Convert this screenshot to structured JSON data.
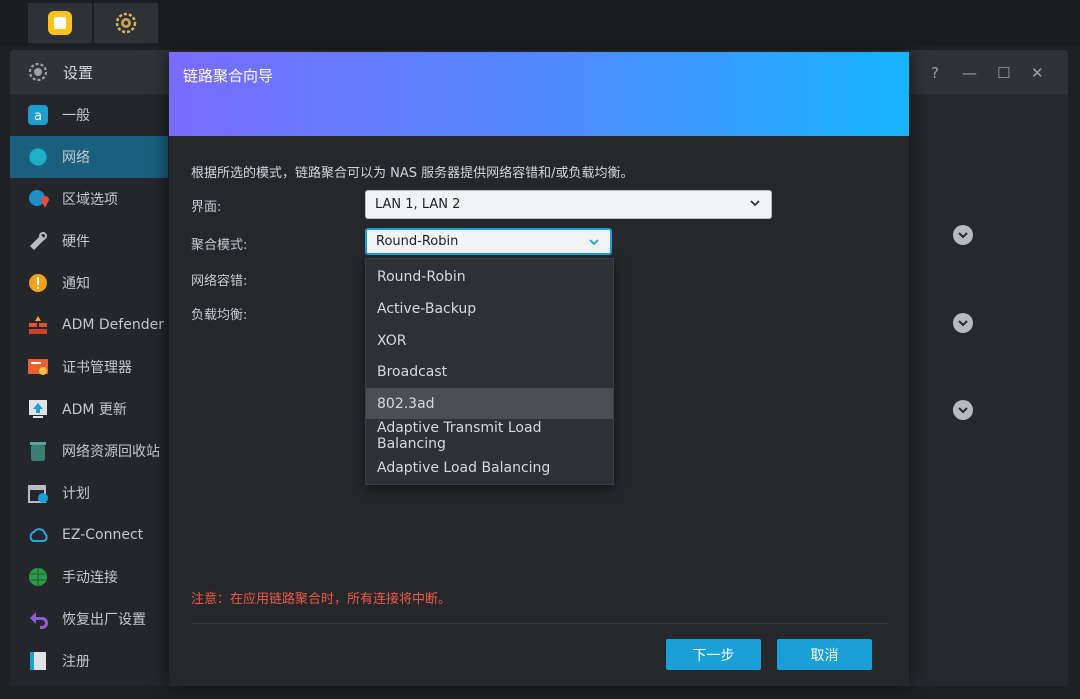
{
  "taskbar": {
    "apps": [
      "photos-app-icon",
      "settings-gear-icon"
    ]
  },
  "window": {
    "title": "设置",
    "controls": {
      "help": "?",
      "minimize": "—",
      "maximize": "☐",
      "close": "✕"
    }
  },
  "sidebar": {
    "items": [
      {
        "label": "一般",
        "icon": "general-icon"
      },
      {
        "label": "网络",
        "icon": "globe-icon",
        "active": true
      },
      {
        "label": "区域选项",
        "icon": "region-globe-icon"
      },
      {
        "label": "硬件",
        "icon": "hardware-icon"
      },
      {
        "label": "通知",
        "icon": "notification-icon"
      },
      {
        "label": "ADM Defender",
        "icon": "firewall-icon"
      },
      {
        "label": "证书管理器",
        "icon": "certificate-icon"
      },
      {
        "label": "ADM 更新",
        "icon": "update-icon"
      },
      {
        "label": "网络资源回收站",
        "icon": "recycle-bin-icon"
      },
      {
        "label": "计划",
        "icon": "calendar-icon"
      },
      {
        "label": "EZ-Connect",
        "icon": "cloud-icon"
      },
      {
        "label": "手动连接",
        "icon": "connect-icon"
      },
      {
        "label": "恢复出厂设置",
        "icon": "reset-icon"
      },
      {
        "label": "注册",
        "icon": "register-icon"
      }
    ]
  },
  "dialog": {
    "title": "链路聚合向导",
    "description": "根据所选的模式，链路聚合可以为 NAS 服务器提供网络容错和/或负载均衡。",
    "labels": {
      "interface": "界面:",
      "mode": "聚合模式:",
      "fault_tolerance": "网络容错:",
      "load_balance": "负载均衡:"
    },
    "interface_value": "LAN 1, LAN 2",
    "mode_value": "Round-Robin",
    "mode_options": [
      "Round-Robin",
      "Active-Backup",
      "XOR",
      "Broadcast",
      "802.3ad",
      "Adaptive Transmit Load Balancing",
      "Adaptive Load Balancing"
    ],
    "highlighted_option": "802.3ad",
    "warning": "注意：在应用链路聚合时，所有连接将中断。",
    "next_button": "下一步",
    "cancel_button": "取消"
  },
  "colors": {
    "accent": "#1aa0d8",
    "warning": "#f05a4a",
    "header_gradient_start": "#7a6bff",
    "header_gradient_end": "#16b4ff",
    "active_nav": "#1a5f7e"
  }
}
